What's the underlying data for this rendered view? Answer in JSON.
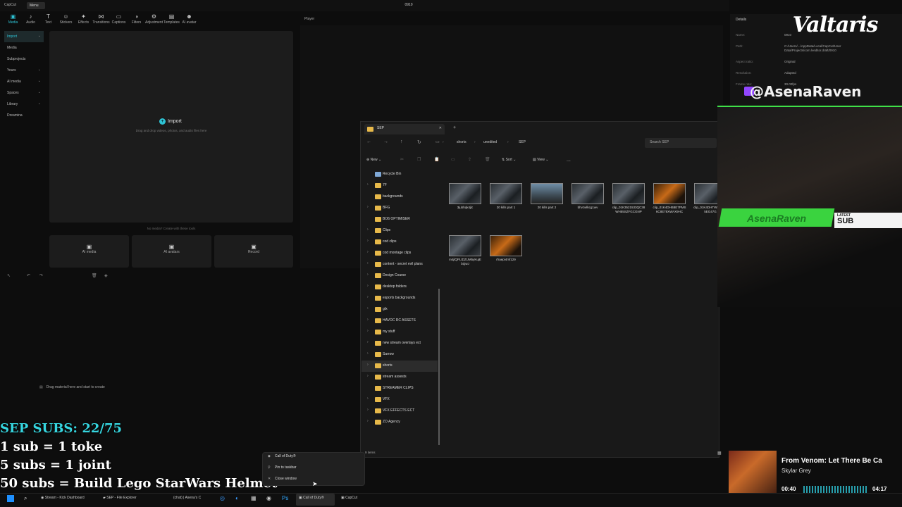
{
  "capcut": {
    "app_name": "CapCut",
    "menu_label": "Menu",
    "project_title": "0910",
    "toolbar": [
      {
        "label": "Media",
        "icon": "media-icon",
        "active": true
      },
      {
        "label": "Audio",
        "icon": "audio-icon"
      },
      {
        "label": "Text",
        "icon": "text-icon"
      },
      {
        "label": "Stickers",
        "icon": "stickers-icon"
      },
      {
        "label": "Effects",
        "icon": "effects-icon"
      },
      {
        "label": "Transitions",
        "icon": "transitions-icon"
      },
      {
        "label": "Captions",
        "icon": "captions-icon"
      },
      {
        "label": "Filters",
        "icon": "filters-icon"
      },
      {
        "label": "Adjustment",
        "icon": "adjustment-icon"
      },
      {
        "label": "Templates",
        "icon": "templates-icon"
      },
      {
        "label": "AI avatar",
        "icon": "ai-avatar-icon"
      }
    ],
    "sidebar": [
      {
        "label": "Import",
        "chevron": true,
        "selected": true
      },
      {
        "label": "Media"
      },
      {
        "label": "Subprojects"
      },
      {
        "label": "Yours",
        "chevron": true
      },
      {
        "label": "AI media",
        "chevron": true
      },
      {
        "label": "Spaces",
        "chevron": true
      },
      {
        "label": "Library",
        "chevron": true
      },
      {
        "label": "Dreamina"
      }
    ],
    "import_label": "Import",
    "import_hint": "Drag and drop videos, photos, and audio files here",
    "no_media": "No media? Create with these tools",
    "create_tools": [
      "AI media",
      "AI avatars",
      "Record"
    ],
    "player_label": "Player",
    "timeline_hint": "Drag material here and start to create",
    "details": {
      "title": "Details",
      "rows": [
        {
          "k": "Name:",
          "v": "0910"
        },
        {
          "k": "Path:",
          "v": "C:/Users/.../AppData/Local/CapCut/User Data/Projects/com.lveditor.draft/0910"
        },
        {
          "k": "Aspect ratio:",
          "v": "Original"
        },
        {
          "k": "Resolution:",
          "v": "Adapted"
        },
        {
          "k": "Frame rate:",
          "v": "30.00fps"
        }
      ]
    }
  },
  "explorer": {
    "tab_title": "SEP",
    "breadcrumb": [
      "shorts",
      "unedited",
      "SEP"
    ],
    "search_placeholder": "Search SEP",
    "commands": {
      "new": "New",
      "sort": "Sort",
      "view": "View",
      "more": "..."
    },
    "tree": [
      {
        "name": "Recycle Bin",
        "bin": true
      },
      {
        "name": "7F",
        "chev": true
      },
      {
        "name": "backgrounds"
      },
      {
        "name": "BFG",
        "chev": true
      },
      {
        "name": "BO6 OPTIMISER"
      },
      {
        "name": "Clips",
        "chev": true
      },
      {
        "name": "cod clips",
        "chev": true
      },
      {
        "name": "cod montage clips",
        "chev": true
      },
      {
        "name": "content - secret evil plans",
        "chev": true
      },
      {
        "name": "Design Course",
        "chev": true
      },
      {
        "name": "desktop folders",
        "chev": true
      },
      {
        "name": "esports backgrounds",
        "chev": true
      },
      {
        "name": "gfx",
        "chev": true
      },
      {
        "name": "HAVOC RC ASSETS",
        "chev": true
      },
      {
        "name": "my stuff",
        "chev": true
      },
      {
        "name": "new stream overlays ect",
        "chev": true
      },
      {
        "name": "Sarrow",
        "chev": true
      },
      {
        "name": "shorts",
        "chev": true,
        "selected": true
      },
      {
        "name": "stream assests",
        "chev": true
      },
      {
        "name": "STREAMER CLIPS"
      },
      {
        "name": "VFX",
        "chev": true
      },
      {
        "name": "VFX EFFECTS ECT",
        "chev": true
      },
      {
        "name": "ZO Agency",
        "chev": true
      }
    ],
    "files": [
      {
        "name": "3jubhqk4jlc",
        "style": "dark"
      },
      {
        "name": "20 kills part 1",
        "style": "dark"
      },
      {
        "name": "20 kills part 2",
        "style": "sky"
      },
      {
        "name": "bhvzwlkcg1wv",
        "style": "dark"
      },
      {
        "name": "clip_01K3521533QC38WH55SZFGCGNP",
        "style": "dark"
      },
      {
        "name": "clip_01K4DHB8E7PMS6C8E78XWAX9HC",
        "style": "fire"
      },
      {
        "name": "clip_01K4DHTWDH83E5EG47G",
        "style": "dark"
      },
      {
        "name": "m4jlQPLtDZUM5yKujEbQwJ",
        "style": "dark"
      },
      {
        "name": "rhaepi4mf129",
        "style": "fire"
      }
    ],
    "status": "9 items"
  },
  "overlay": {
    "handle": "@AsenaRaven",
    "banner_name": "AsenaRaven",
    "latest_label": "LATEST",
    "latest_value": "SUB",
    "logo": "Valtaris",
    "sub_goal": [
      "SEP SUBS: 22/75",
      "1 sub = 1 toke",
      "5 subs = 1 joint",
      "50 subs = Build Lego StarWars Helmet"
    ],
    "music": {
      "title": "From Venom: Let There Be Ca",
      "artist": "Skylar Grey",
      "current": "00:40",
      "total": "04:17"
    }
  },
  "context_menu": [
    "Call of Duty®",
    "Pin to taskbar",
    "Close window"
  ],
  "taskbar": {
    "items": [
      "Stream - Kick Dashboard",
      "SEP - File Explorer",
      "(chat) | Asena's C",
      "Call of Duty®",
      "CapCut"
    ]
  }
}
